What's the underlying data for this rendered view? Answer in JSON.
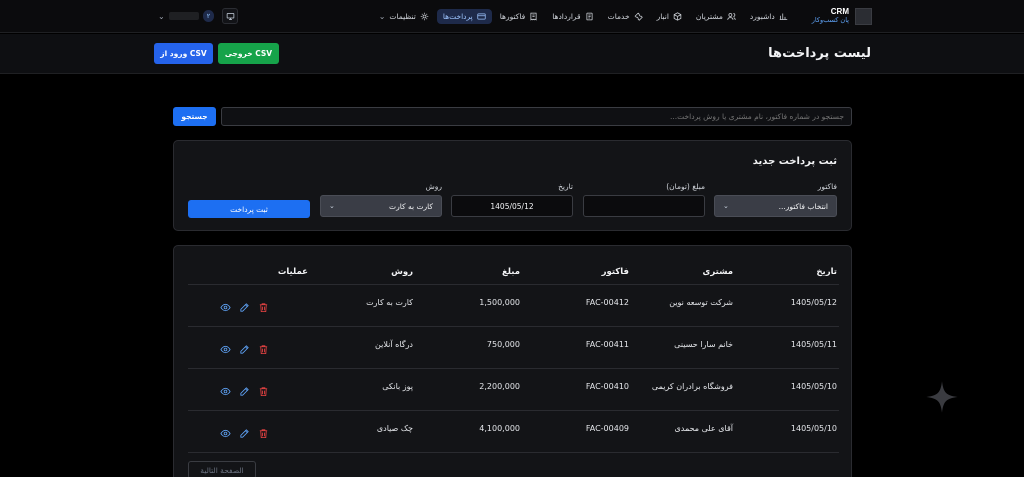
{
  "brand": {
    "name": "CRM",
    "subtitle": "پان کسب‌وکار"
  },
  "nav": {
    "items": [
      {
        "label": "داشبورد",
        "icon": "chart-icon"
      },
      {
        "label": "مشتریان",
        "icon": "users-icon"
      },
      {
        "label": "انبار",
        "icon": "box-icon"
      },
      {
        "label": "خدمات",
        "icon": "wrench-icon"
      },
      {
        "label": "قراردادها",
        "icon": "contract-icon"
      },
      {
        "label": "فاکتورها",
        "icon": "invoice-icon"
      },
      {
        "label": "پرداخت‌ها",
        "icon": "card-icon",
        "active": true
      },
      {
        "label": "تنظیمات",
        "icon": "sun-icon",
        "has_dropdown": true
      }
    ],
    "user_badge": "۲"
  },
  "page": {
    "title": "لیست پرداخت‌ها",
    "export_label": "خروجی CSV",
    "import_label": "ورود از CSV"
  },
  "search": {
    "placeholder": "جستجو در شماره فاکتور، نام مشتری یا روش پرداخت...",
    "button_label": "جستجو"
  },
  "form": {
    "title": "ثبت پرداخت جدید",
    "invoice_label": "فاکتور",
    "invoice_value": "انتخاب فاکتور...",
    "amount_label": "مبلغ (تومان)",
    "amount_value": "",
    "date_label": "تاریخ",
    "date_value": "1405/05/12",
    "method_label": "روش",
    "method_value": "کارت به کارت",
    "submit_label": "ثبت پرداخت"
  },
  "table": {
    "headers": {
      "date": "تاریخ",
      "customer": "مشتری",
      "invoice": "فاکتور",
      "amount": "مبلغ",
      "method": "روش",
      "ops": "عملیات"
    },
    "rows": [
      {
        "date": "1405/05/12",
        "customer": "شرکت توسعه نوین",
        "invoice": "FAC-00412",
        "amount": "1,500,000",
        "method": "کارت به کارت"
      },
      {
        "date": "1405/05/11",
        "customer": "خانم سارا حسینی",
        "invoice": "FAC-00411",
        "amount": "750,000",
        "method": "درگاه آنلاین"
      },
      {
        "date": "1405/05/10",
        "customer": "فروشگاه برادران کریمی",
        "invoice": "FAC-00410",
        "amount": "2,200,000",
        "method": "پوز بانکی"
      },
      {
        "date": "1405/05/10",
        "customer": "آقای علی محمدی",
        "invoice": "FAC-00409",
        "amount": "4,100,000",
        "method": "چک صیادی"
      }
    ],
    "next_page_label": "الصفحة التالية"
  }
}
